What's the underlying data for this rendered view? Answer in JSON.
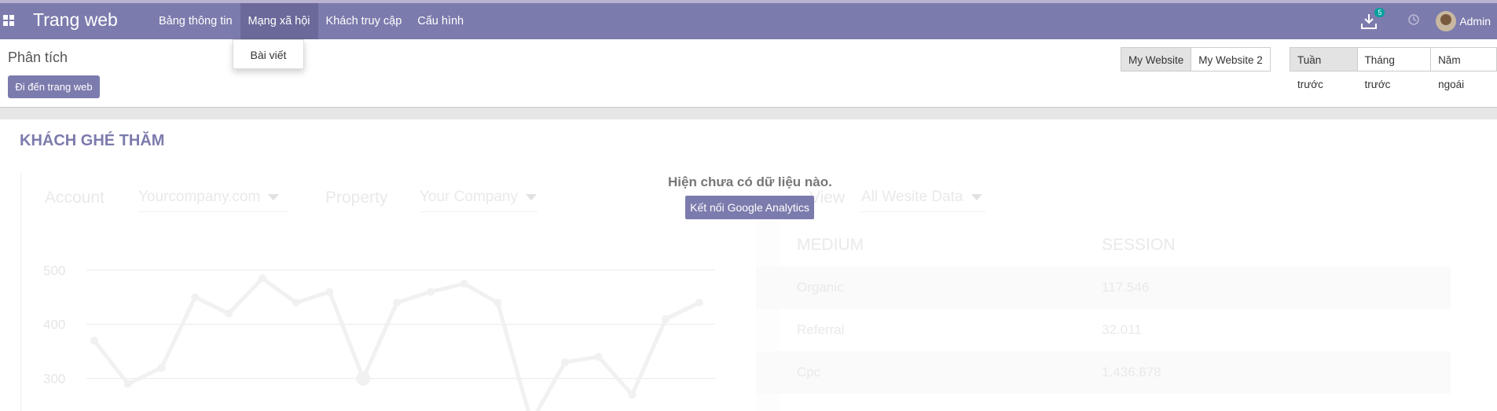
{
  "app": {
    "brand": "Trang web"
  },
  "nav": [
    {
      "label": "Bảng thông tin",
      "active": false
    },
    {
      "label": "Mạng xã hội",
      "active": true
    },
    {
      "label": "Khách truy cập",
      "active": false
    },
    {
      "label": "Cấu hình",
      "active": false
    }
  ],
  "dropdown": {
    "item": "Bài viết"
  },
  "systray": {
    "download_badge": "5",
    "user": "Admin",
    "icons": [
      "download-icon",
      "clock-icon"
    ]
  },
  "control_panel": {
    "title": "Phân tích",
    "go_to_website": "Đi đến trang web",
    "websites": [
      "My Website",
      "My Website 2"
    ],
    "periods": [
      "Tuần trước",
      "Tháng trước",
      "Năm ngoái"
    ]
  },
  "section": {
    "title": "KHÁCH GHÉ THĂM",
    "no_data": "Hiện chưa có dữ liệu nào.",
    "connect_button": "Kết nối Google Analytics"
  },
  "ga_filters": {
    "account_label": "Account",
    "account_value": "Yourcompany.com",
    "property_label": "Property",
    "property_value": "Your Company",
    "view_label": "View",
    "view_value": "All Wesite Data"
  },
  "table": {
    "headers": [
      "MEDIUM",
      "SESSION"
    ],
    "rows": [
      [
        "Organic",
        "117.546"
      ],
      [
        "Referral",
        "32.011"
      ],
      [
        "Cpc",
        "1.436.678"
      ]
    ]
  },
  "chart_data": {
    "type": "line",
    "y_ticks": [
      500,
      400,
      300
    ],
    "ylim": [
      240,
      520
    ],
    "values": [
      370,
      290,
      320,
      450,
      420,
      485,
      440,
      460,
      300,
      440,
      460,
      475,
      440,
      220,
      330,
      340,
      270,
      410,
      440
    ],
    "color": "#bdbdbd"
  }
}
